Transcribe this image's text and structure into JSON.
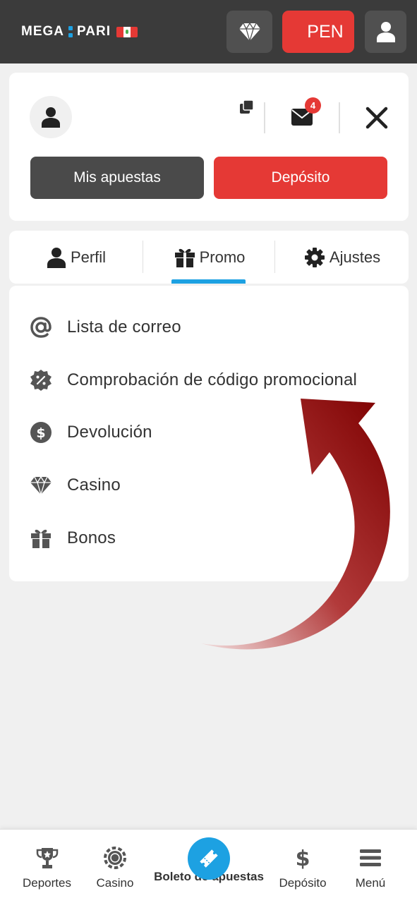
{
  "header": {
    "logo_left": "MEGA",
    "logo_right": "PARI",
    "currency_label": "PEN"
  },
  "profile": {
    "mail_count": "4",
    "my_bets_label": "Mis apuestas",
    "deposit_label": "Depósito"
  },
  "tabs": [
    {
      "label": "Perfil",
      "icon": "person-icon"
    },
    {
      "label": "Promo",
      "icon": "gift-icon",
      "active": true
    },
    {
      "label": "Ajustes",
      "icon": "gear-icon"
    }
  ],
  "promo_menu": [
    {
      "label": "Lista de correo",
      "icon": "at-icon"
    },
    {
      "label": "Comprobación de código promocional",
      "icon": "percent-badge-icon"
    },
    {
      "label": "Devolución",
      "icon": "dollar-circle-icon"
    },
    {
      "label": "Casino",
      "icon": "diamond-icon"
    },
    {
      "label": "Bonos",
      "icon": "gift-icon"
    }
  ],
  "bottom_nav": [
    {
      "label": "Deportes",
      "icon": "trophy-icon"
    },
    {
      "label": "Casino",
      "icon": "chip-icon"
    },
    {
      "label": "Boleto de apuestas",
      "icon": "ticket-icon"
    },
    {
      "label": "Depósito",
      "icon": "dollar-icon"
    },
    {
      "label": "Menú",
      "icon": "hamburger-icon"
    }
  ],
  "colors": {
    "header_bg": "#3b3b3b",
    "accent_red": "#e53935",
    "accent_blue": "#1da1e2",
    "arrow_red": "#8b0000"
  }
}
